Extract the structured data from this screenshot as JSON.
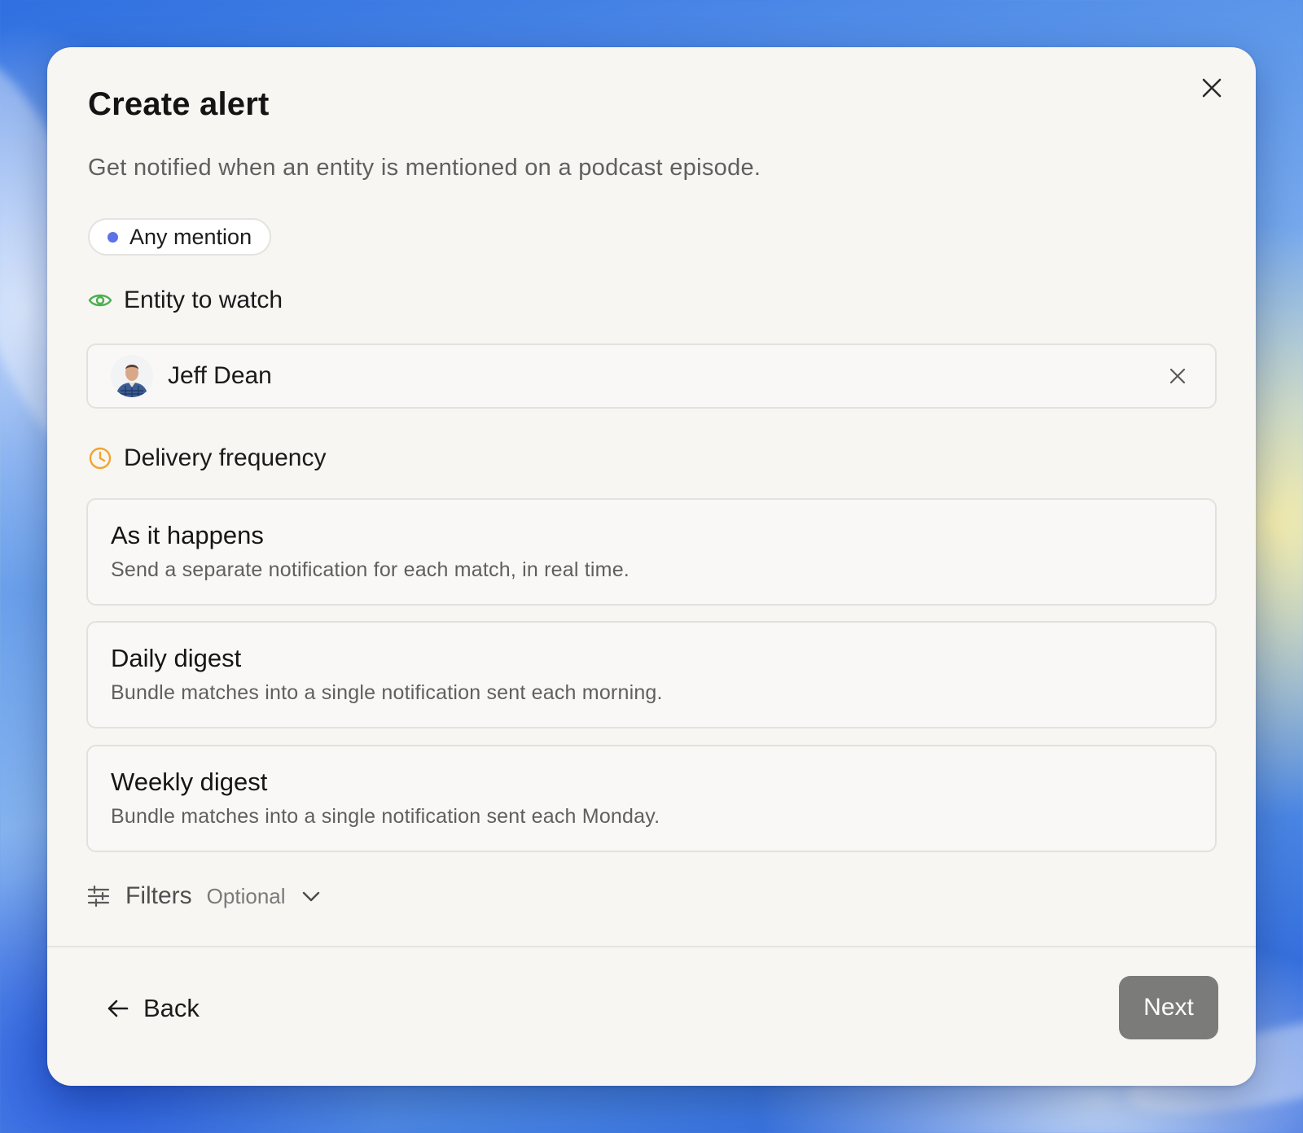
{
  "dialog": {
    "title": "Create alert",
    "subtitle": "Get notified when an entity is mentioned on a podcast episode.",
    "close_icon": "close-icon"
  },
  "mention_type": {
    "label": "Any mention",
    "dot_color": "#5b72e8"
  },
  "entity_section": {
    "label": "Entity to watch",
    "icon": "eye-icon",
    "icon_color": "#4caf50",
    "selected_entity": {
      "name": "Jeff Dean",
      "avatar": "avatar"
    },
    "clear_icon": "close-icon"
  },
  "frequency_section": {
    "label": "Delivery frequency",
    "icon": "clock-icon",
    "icon_color": "#f0a530",
    "options": [
      {
        "title": "As it happens",
        "description": "Send a separate notification for each match, in real time."
      },
      {
        "title": "Daily digest",
        "description": "Bundle matches into a single notification sent each morning."
      },
      {
        "title": "Weekly digest",
        "description": "Bundle matches into a single notification sent each Monday."
      }
    ]
  },
  "filters": {
    "label": "Filters",
    "optional_label": "Optional",
    "icon": "sliders-icon",
    "chevron": "chevron-down-icon"
  },
  "footer": {
    "back_label": "Back",
    "next_label": "Next",
    "next_color": "#7b7b7a"
  }
}
